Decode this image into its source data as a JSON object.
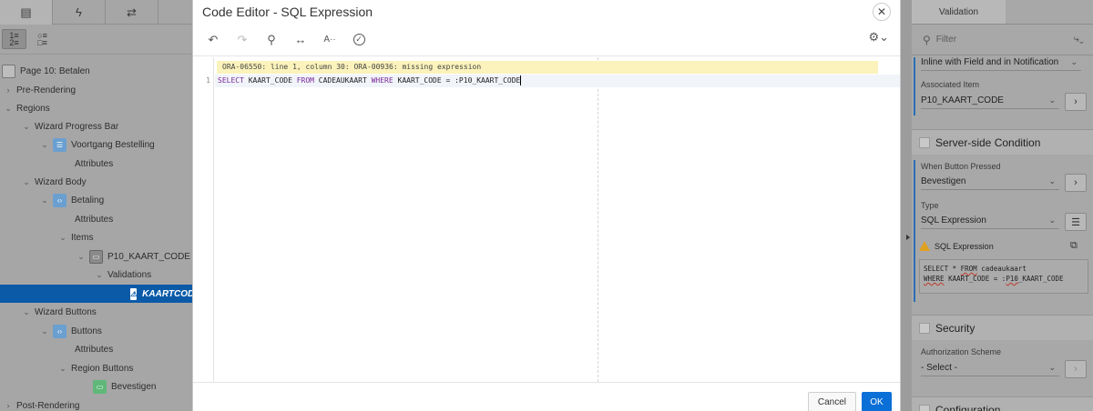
{
  "left_panel": {
    "tabs": [
      {
        "icon": "rendering-tree-icon",
        "glyph": "▤"
      },
      {
        "icon": "lightning-icon",
        "glyph": "ϟ"
      },
      {
        "icon": "processing-icon",
        "glyph": "⇄"
      }
    ],
    "tree": [
      {
        "label": "Page 10: Betalen",
        "chevron": "",
        "icon": "page-icon"
      },
      {
        "label": "Pre-Rendering",
        "chevron": "›",
        "icon": ""
      },
      {
        "label": "Regions",
        "chevron": "⌄",
        "icon": ""
      },
      {
        "label": "Wizard Progress Bar",
        "chevron": "⌄",
        "icon": ""
      },
      {
        "label": "Voortgang Bestelling",
        "chevron": "⌄",
        "icon": "list-icon"
      },
      {
        "label": "Attributes",
        "chevron": "",
        "icon": ""
      },
      {
        "label": "Wizard Body",
        "chevron": "⌄",
        "icon": ""
      },
      {
        "label": "Betaling",
        "chevron": "⌄",
        "icon": "code-icon"
      },
      {
        "label": "Attributes",
        "chevron": "",
        "icon": ""
      },
      {
        "label": "Items",
        "chevron": "⌄",
        "icon": ""
      },
      {
        "label": "P10_KAART_CODE",
        "chevron": "⌄",
        "icon": "item-icon"
      },
      {
        "label": "Validations",
        "chevron": "⌄",
        "icon": ""
      },
      {
        "label": "KAARTCODE",
        "chevron": "",
        "icon": "validation-warning-icon"
      },
      {
        "label": "Wizard Buttons",
        "chevron": "⌄",
        "icon": ""
      },
      {
        "label": "Buttons",
        "chevron": "⌄",
        "icon": "code-icon"
      },
      {
        "label": "Attributes",
        "chevron": "",
        "icon": ""
      },
      {
        "label": "Region Buttons",
        "chevron": "⌄",
        "icon": ""
      },
      {
        "label": "Bevestigen",
        "chevron": "",
        "icon": "button-icon"
      },
      {
        "label": "Post-Rendering",
        "chevron": "›",
        "icon": ""
      }
    ]
  },
  "dialog": {
    "title": "Code Editor - SQL Expression",
    "close_glyph": "✕",
    "toolbar": {
      "undo_glyph": "↶",
      "redo_glyph": "↷",
      "search_glyph": "⚲",
      "replace_glyph": "↔",
      "autocomplete_glyph": "A··",
      "validate_glyph": "✓",
      "settings_glyph": "⚙⌄"
    },
    "editor": {
      "error_message": "ORA-06550: line 1, column 30: ORA-00936: missing expression",
      "line_number": "1",
      "code_tokens": [
        {
          "t": "SELECT",
          "kw": true
        },
        {
          "t": " KAART_CODE ",
          "kw": false
        },
        {
          "t": "FROM",
          "kw": true
        },
        {
          "t": " CADEAUKAART ",
          "kw": false
        },
        {
          "t": "WHERE",
          "kw": true
        },
        {
          "t": " KAART_CODE = :P10_KAART_CODE",
          "kw": false
        }
      ]
    },
    "cancel_label": "Cancel",
    "ok_label": "OK"
  },
  "right_panel": {
    "tab_label": "Validation",
    "filter_placeholder": "Filter",
    "display_location_value": "Inline with Field and in Notification",
    "associated_item_label": "Associated Item",
    "associated_item_value": "P10_KAART_CODE",
    "server_side_condition_title": "Server-side Condition",
    "when_button_pressed_label": "When Button Pressed",
    "when_button_pressed_value": "Bevestigen",
    "type_label": "Type",
    "type_value": "SQL Expression",
    "sql_expression_label": "SQL Expression",
    "sql_line1_a": "SELECT * ",
    "sql_line1_b": "FROM",
    "sql_line1_c": " cadeaukaart",
    "sql_line2_a": "WHERE",
    "sql_line2_b": " KAART_CODE = :",
    "sql_line2_c": "P10",
    "sql_line2_d": "_KAART_CODE",
    "security_title": "Security",
    "authorization_scheme_label": "Authorization Scheme",
    "authorization_scheme_value": "- Select -",
    "configuration_title": "Configuration"
  },
  "colors": {
    "selected_row": "#0a5aa8",
    "ok_button": "#0a6fd6",
    "error_bar": "#fbf3bb",
    "keyword": "#7a2a98"
  }
}
